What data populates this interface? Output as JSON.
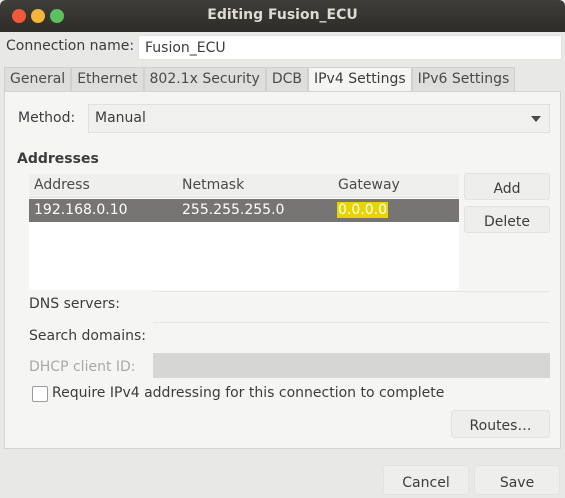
{
  "window": {
    "title": "Editing Fusion_ECU"
  },
  "connection": {
    "label": "Connection name:",
    "value": "Fusion_ECU"
  },
  "tabs": [
    {
      "label": "General"
    },
    {
      "label": "Ethernet"
    },
    {
      "label": "802.1x Security"
    },
    {
      "label": "DCB"
    },
    {
      "label": "IPv4 Settings"
    },
    {
      "label": "IPv6 Settings"
    }
  ],
  "active_tab": "IPv4 Settings",
  "method": {
    "label": "Method:",
    "value": "Manual"
  },
  "addresses": {
    "heading": "Addresses",
    "columns": [
      "Address",
      "Netmask",
      "Gateway"
    ],
    "rows": [
      {
        "address": "192.168.0.10",
        "netmask": "255.255.255.0",
        "gateway": "0.0.0.0"
      }
    ],
    "add_label": "Add",
    "delete_label": "Delete"
  },
  "fields": {
    "dns_label": "DNS servers:",
    "search_label": "Search domains:",
    "dhcp_label": "DHCP client ID:"
  },
  "require_ipv4": {
    "label": "Require IPv4 addressing for this connection to complete",
    "checked": false
  },
  "routes_label": "Routes…",
  "footer": {
    "cancel_label": "Cancel",
    "save_label": "Save"
  }
}
